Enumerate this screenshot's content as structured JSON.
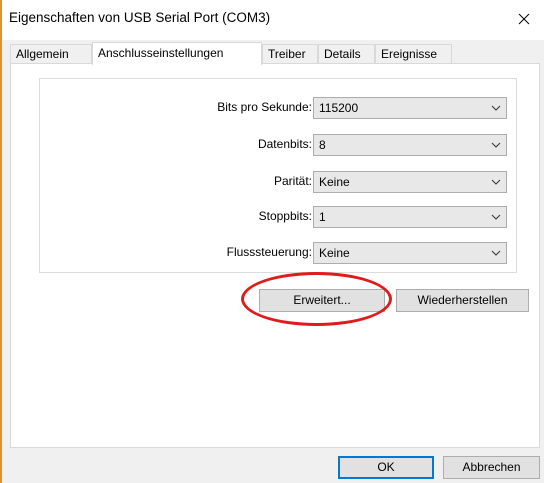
{
  "window": {
    "title": "Eigenschaften von USB Serial Port (COM3)",
    "accent_color": "#0078d7",
    "annotation_color": "#e01b1b"
  },
  "tabs": [
    {
      "label": "Allgemein"
    },
    {
      "label": "Anschlusseinstellungen",
      "active": true
    },
    {
      "label": "Treiber"
    },
    {
      "label": "Details"
    },
    {
      "label": "Ereignisse"
    }
  ],
  "settings": {
    "bits_per_second": {
      "label": "Bits pro Sekunde:",
      "value": "115200"
    },
    "data_bits": {
      "label": "Datenbits:",
      "value": "8"
    },
    "parity": {
      "label": "Parität:",
      "value": "Keine"
    },
    "stop_bits": {
      "label": "Stoppbits:",
      "value": "1"
    },
    "flow_control": {
      "label": "Flusssteuerung:",
      "value": "Keine"
    }
  },
  "buttons": {
    "advanced": "Erweitert...",
    "restore": "Wiederherstellen",
    "ok": "OK",
    "cancel": "Abbrechen"
  },
  "icons": {
    "close": "close-icon",
    "dropdown": "chevron-down-icon"
  }
}
